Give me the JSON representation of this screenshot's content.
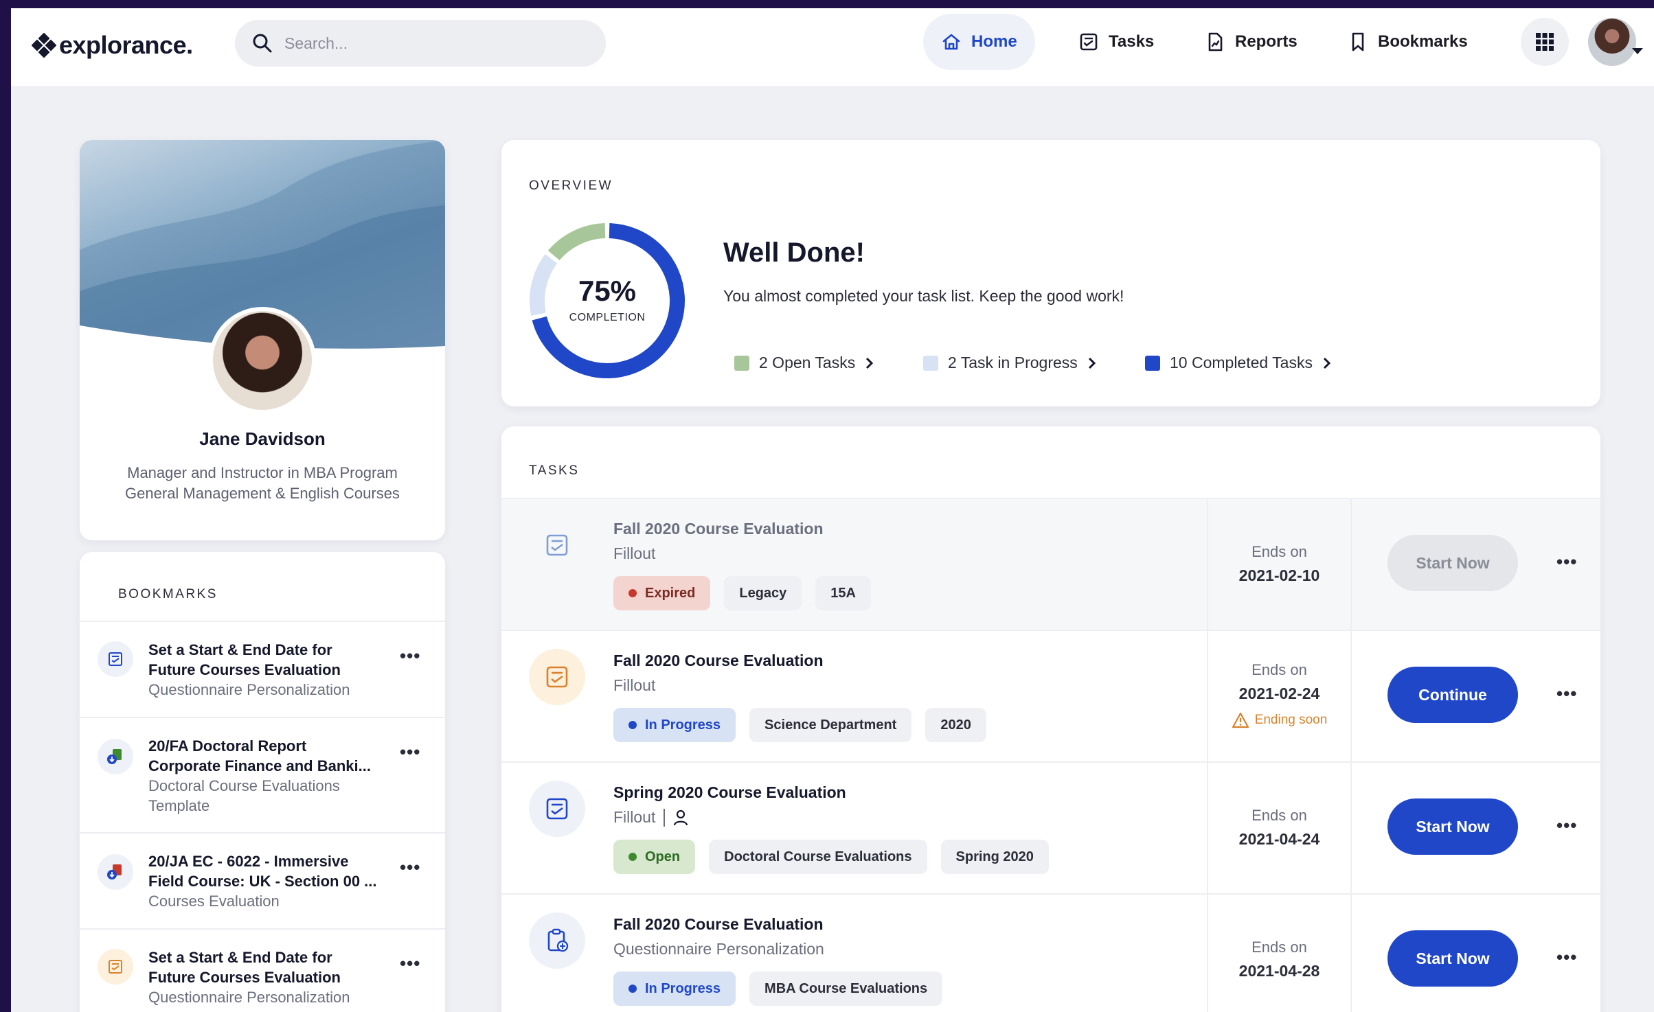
{
  "brand": {
    "name": "explorance.",
    "color": "#15172b"
  },
  "search": {
    "placeholder": "Search..."
  },
  "nav": {
    "items": [
      {
        "label": "Home",
        "icon": "home-icon",
        "active": true
      },
      {
        "label": "Tasks",
        "icon": "tasks-icon",
        "active": false
      },
      {
        "label": "Reports",
        "icon": "reports-icon",
        "active": false
      },
      {
        "label": "Bookmarks",
        "icon": "bookmark-icon",
        "active": false
      }
    ],
    "apps_icon": "grid-icon"
  },
  "colors": {
    "primary": "#1f47c7",
    "open": "#a7c79a",
    "in_progress": "#d7e2f4",
    "completed": "#1f47c7",
    "expired": "#c63a2e",
    "warning": "#d9822b"
  },
  "profile": {
    "name": "Jane Davidson",
    "role_line1": "Manager and Instructor in MBA Program",
    "role_line2": "General Management & English Courses"
  },
  "bookmarks": {
    "heading": "BOOKMARKS",
    "items": [
      {
        "title_line1": "Set a Start & End Date for",
        "title_line2": "Future Courses Evaluation",
        "sub_line1": "Questionnaire Personalization",
        "sub_line2": "",
        "icon": "checklist-icon"
      },
      {
        "title_line1": "20/FA Doctoral Report",
        "title_line2": "Corporate Finance and Banki...",
        "sub_line1": "Doctoral Course Evaluations",
        "sub_line2": "Template",
        "icon": "report-download-icon"
      },
      {
        "title_line1": "20/JA EC - 6022 - Immersive",
        "title_line2": "Field Course: UK - Section 00 ...",
        "sub_line1": "Courses Evaluation",
        "sub_line2": "",
        "icon": "pdf-download-icon"
      },
      {
        "title_line1": "Set a Start & End Date for",
        "title_line2": "Future Courses Evaluation",
        "sub_line1": "Questionnaire Personalization",
        "sub_line2": "",
        "icon": "checklist-icon"
      }
    ]
  },
  "overview": {
    "heading": "OVERVIEW",
    "completion_value": "75%",
    "completion_label": "COMPLETION",
    "title": "Well Done!",
    "message": "You almost completed your task list. Keep the good work!",
    "segments": {
      "open": 2,
      "in_progress": 2,
      "completed": 10
    },
    "legend": [
      {
        "label": "2 Open Tasks",
        "color": "#a7c79a"
      },
      {
        "label": "2 Task in Progress",
        "color": "#d7e2f4"
      },
      {
        "label": "10 Completed Tasks",
        "color": "#1f47c7"
      }
    ]
  },
  "tasks": {
    "heading": "TASKS",
    "ends_label": "Ends on",
    "items": [
      {
        "title": "Fall 2020 Course Evaluation",
        "subtitle": "Fillout",
        "status": "Expired",
        "status_bg": "#f3d4cf",
        "status_dot": "#c63a2e",
        "tags": [
          "Legacy",
          "15A"
        ],
        "end_date": "2021-02-10",
        "warning": "",
        "button": "Start Now",
        "button_style": "disabled",
        "icon": "checklist-icon"
      },
      {
        "title": "Fall 2020 Course Evaluation",
        "subtitle": "Fillout",
        "status": "In Progress",
        "status_bg": "#d7e2f4",
        "status_dot": "#1f47c7",
        "tags": [
          "Science Department",
          "2020"
        ],
        "end_date": "2021-02-24",
        "warning": "Ending soon",
        "button": "Continue",
        "button_style": "primary",
        "icon": "checklist-icon"
      },
      {
        "title": "Spring 2020 Course Evaluation",
        "subtitle": "Fillout",
        "status": "Open",
        "status_bg": "#d7e8cf",
        "status_dot": "#3f8a2f",
        "tags": [
          "Doctoral Course Evaluations",
          "Spring 2020"
        ],
        "end_date": "2021-04-24",
        "warning": "",
        "button": "Start Now",
        "button_style": "primary",
        "icon": "checklist-icon"
      },
      {
        "title": "Fall 2020 Course Evaluation",
        "subtitle": "Questionnaire Personalization",
        "status": "In Progress",
        "status_bg": "#d7e2f4",
        "status_dot": "#1f47c7",
        "tags": [
          "MBA Course Evaluations"
        ],
        "end_date": "2021-04-28",
        "warning": "",
        "button": "Start Now",
        "button_style": "primary",
        "icon": "clipboard-add-icon"
      }
    ]
  }
}
